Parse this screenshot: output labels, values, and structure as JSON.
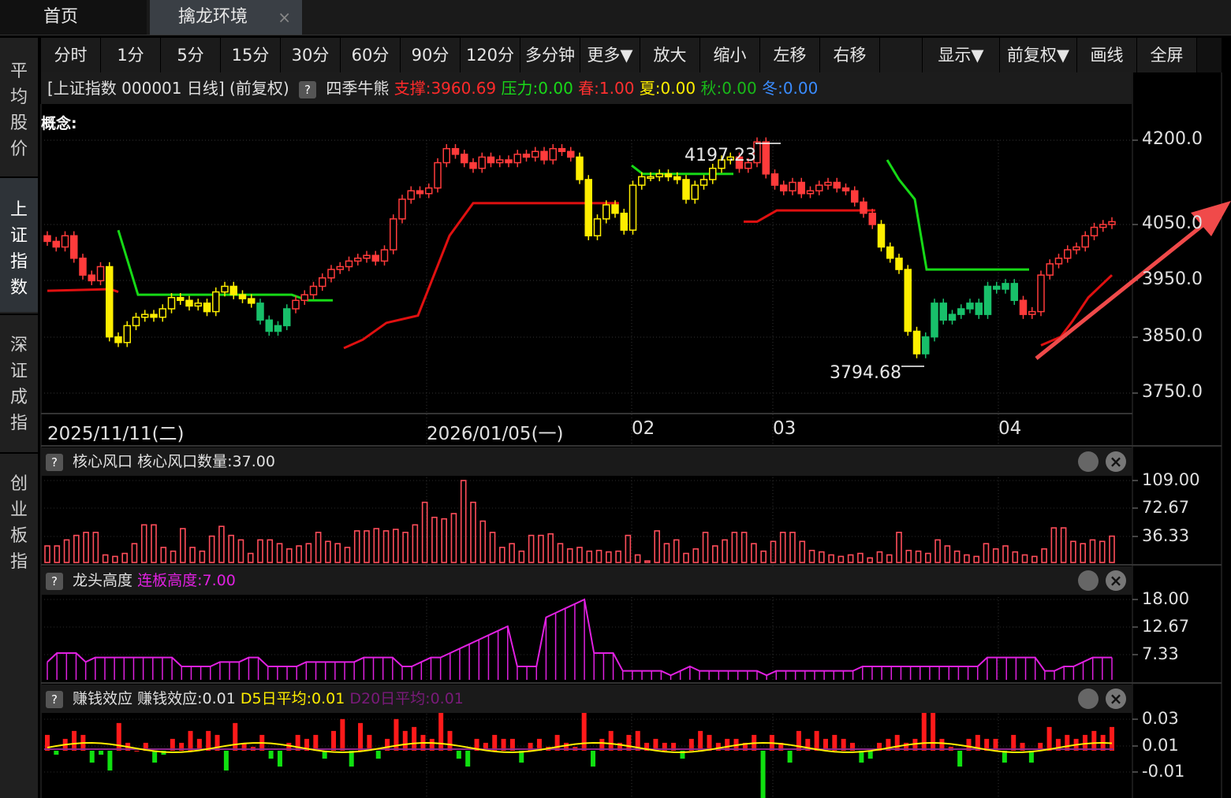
{
  "tabs": {
    "home": "首页",
    "active": "擒龙环境",
    "close": "×"
  },
  "sidebar": [
    "平均股价",
    "上证指数",
    "深证成指",
    "创业板指"
  ],
  "toolbar": [
    "分时",
    "1分",
    "5分",
    "15分",
    "30分",
    "60分",
    "90分",
    "120分",
    "多分钟",
    "更多▼",
    "放大",
    "缩小",
    "左移",
    "右移",
    "",
    "显示▼",
    "前复权▼",
    "画线",
    "全屏"
  ],
  "info": {
    "title": "[上证指数 000001 日线] (前复权)",
    "qmark": "?",
    "indicator": "四季牛熊",
    "support": "支撑:3960.69",
    "pressure": "压力:0.00",
    "spring": "春:1.00",
    "summer": "夏:0.00",
    "autumn": "秋:0.00",
    "winter": "冬:0.00",
    "concept": "概念:"
  },
  "price_axis": [
    "4200.0",
    "4050.0",
    "3950.0",
    "3850.0",
    "3750.0"
  ],
  "annotations": {
    "high": "4197.23",
    "low": "3794.68"
  },
  "dates": [
    "2025/11/11(二)",
    "2026/01/05(一)",
    "02",
    "03",
    "04"
  ],
  "panel1": {
    "name": "核心风口",
    "text": "核心风口数量:37.00",
    "axis": [
      "109.00",
      "72.67",
      "36.33"
    ]
  },
  "panel2": {
    "name": "龙头高度",
    "text": "连板高度:7.00",
    "axis": [
      "18.00",
      "12.67",
      "7.33"
    ]
  },
  "panel3": {
    "name": "赚钱效应",
    "text": "赚钱效应:0.01",
    "d5": "D5日平均:0.01",
    "d20": "D20日平均:0.01",
    "axis": [
      "0.03",
      "0.01",
      "-0.01"
    ]
  },
  "colors": {
    "up": "#ff3b3b",
    "down": "#18c06a",
    "yellow": "#ffee00",
    "support_line": "#e01010",
    "pressure_line": "#16d916",
    "magenta": "#e020e0",
    "arrow": "#f04a4a"
  },
  "icons": {
    "gear": "gear-icon",
    "close": "close-icon",
    "help": "help-icon"
  },
  "chart_data": [
    {
      "type": "candlestick",
      "title": "[上证指数 000001 日线] (前复权)",
      "ylim": [
        3740,
        4230
      ],
      "series": [
        {
          "name": "四季牛熊",
          "values_close": [
            4020,
            4010,
            4030,
            3990,
            3960,
            3950,
            3975,
            3850,
            3840,
            3870,
            3885,
            3890,
            3885,
            3900,
            3920,
            3915,
            3905,
            3910,
            3895,
            3930,
            3940,
            3925,
            3918,
            3910,
            3880,
            3860,
            3870,
            3900,
            3915,
            3925,
            3940,
            3955,
            3970,
            3975,
            3985,
            3990,
            3995,
            3985,
            4005,
            4060,
            4095,
            4110,
            4105,
            4115,
            4160,
            4185,
            4175,
            4160,
            4150,
            4170,
            4160,
            4165,
            4160,
            4175,
            4170,
            4180,
            4165,
            4185,
            4180,
            4170,
            4130,
            4030,
            4060,
            4085,
            4070,
            4040,
            4120,
            4135,
            4135,
            4140,
            4135,
            4130,
            4095,
            4120,
            4130,
            4150,
            4165,
            4170,
            4150,
            4160,
            4197,
            4140,
            4120,
            4110,
            4125,
            4105,
            4110,
            4120,
            4125,
            4115,
            4110,
            4090,
            4070,
            4050,
            4010,
            3990,
            3970,
            3860,
            3820,
            3850,
            3910,
            3880,
            3890,
            3900,
            3910,
            3890,
            3940,
            3935,
            3945,
            3915,
            3890,
            3895,
            3960,
            3980,
            3990,
            4005,
            4010,
            4030,
            4045,
            4050,
            4055
          ]
        }
      ],
      "support_line": "red stepped line below price",
      "pressure_line": "green stepped line above price"
    },
    {
      "type": "bar",
      "title": "核心风口",
      "ylim": [
        0,
        109
      ],
      "values": [
        22,
        22,
        30,
        36,
        40,
        40,
        10,
        8,
        12,
        25,
        50,
        50,
        20,
        15,
        45,
        20,
        15,
        35,
        48,
        36,
        30,
        12,
        30,
        30,
        25,
        18,
        22,
        25,
        40,
        28,
        25,
        20,
        42,
        42,
        45,
        42,
        44,
        40,
        50,
        80,
        60,
        58,
        65,
        109,
        80,
        55,
        40,
        20,
        25,
        15,
        36,
        36,
        38,
        25,
        18,
        20,
        15,
        16,
        14,
        15,
        36,
        10,
        2,
        42,
        25,
        30,
        12,
        18,
        40,
        22,
        30,
        40,
        40,
        25,
        15,
        28,
        40,
        40,
        28,
        16,
        14,
        10,
        8,
        10,
        12,
        6,
        14,
        10,
        40,
        16,
        15,
        12,
        30,
        22,
        15,
        10,
        8,
        25,
        18,
        22,
        14,
        10,
        8,
        18,
        46,
        46,
        28,
        25,
        30,
        28,
        35
      ]
    },
    {
      "type": "bar",
      "title": "龙头高度",
      "ylim": [
        0,
        18
      ],
      "values": [
        4,
        6,
        6,
        6,
        4,
        5,
        5,
        5,
        5,
        5,
        5,
        5,
        5,
        5,
        3,
        3,
        3,
        3,
        4,
        4,
        4,
        5,
        5,
        3,
        3,
        3,
        3,
        4,
        4,
        4,
        4,
        4,
        4,
        5,
        5,
        5,
        5,
        3,
        3,
        4,
        5,
        5,
        6,
        7,
        8,
        9,
        10,
        11,
        12,
        3,
        3,
        3,
        14,
        15,
        16,
        17,
        18,
        6,
        6,
        6,
        2,
        2,
        2,
        2,
        2,
        1,
        2,
        3,
        2,
        2,
        2,
        2,
        2,
        2,
        2,
        1,
        2,
        2,
        2,
        2,
        2,
        2,
        2,
        2,
        2,
        3,
        3,
        3,
        3,
        3,
        3,
        3,
        3,
        3,
        3,
        3,
        3,
        3,
        5,
        5,
        5,
        5,
        5,
        5,
        2,
        2,
        3,
        3,
        4,
        5,
        5,
        5
      ]
    },
    {
      "type": "bar",
      "title": "赚钱效应",
      "ylim": [
        -0.02,
        0.035
      ],
      "values": [
        0.004,
        -0.001,
        0.003,
        0.005,
        0.004,
        -0.003,
        -0.001,
        -0.005,
        0.007,
        0.002,
        0.0,
        0.002,
        -0.003,
        -0.001,
        0.003,
        0.002,
        0.005,
        0.003,
        0.005,
        0.004,
        -0.005,
        0.007,
        0.002,
        0.001,
        0.004,
        -0.002,
        -0.004,
        0.002,
        0.004,
        0.003,
        0.004,
        -0.002,
        0.005,
        0.008,
        -0.004,
        0.007,
        0.004,
        -0.002,
        0.003,
        0.008,
        0.005,
        0.006,
        0.004,
        0.003,
        0.012,
        0.005,
        -0.002,
        -0.004,
        0.003,
        0.002,
        0.004,
        0.003,
        0.003,
        -0.003,
        0.002,
        0.003,
        0.001,
        0.004,
        0.002,
        0.001,
        0.012,
        -0.004,
        0.003,
        0.005,
        0.002,
        0.004,
        0.005,
        0.002,
        0.003,
        0.002,
        0.002,
        -0.002,
        0.003,
        0.005,
        0.004,
        0.002,
        0.003,
        0.003,
        0.002,
        0.004,
        -0.012,
        0.004,
        0.002,
        -0.003,
        0.005,
        0.003,
        0.005,
        0.003,
        0.004,
        0.003,
        0.002,
        -0.003,
        -0.002,
        0.002,
        0.003,
        0.004,
        0.002,
        0.003,
        0.012,
        0.011,
        0.003,
        0.001,
        -0.004,
        0.003,
        0.004,
        0.003,
        0.003,
        -0.003,
        0.004,
        0.002,
        -0.003,
        0.002,
        0.006,
        0.003,
        0.004,
        0.003,
        0.004,
        0.005,
        0.004,
        0.006
      ]
    }
  ]
}
